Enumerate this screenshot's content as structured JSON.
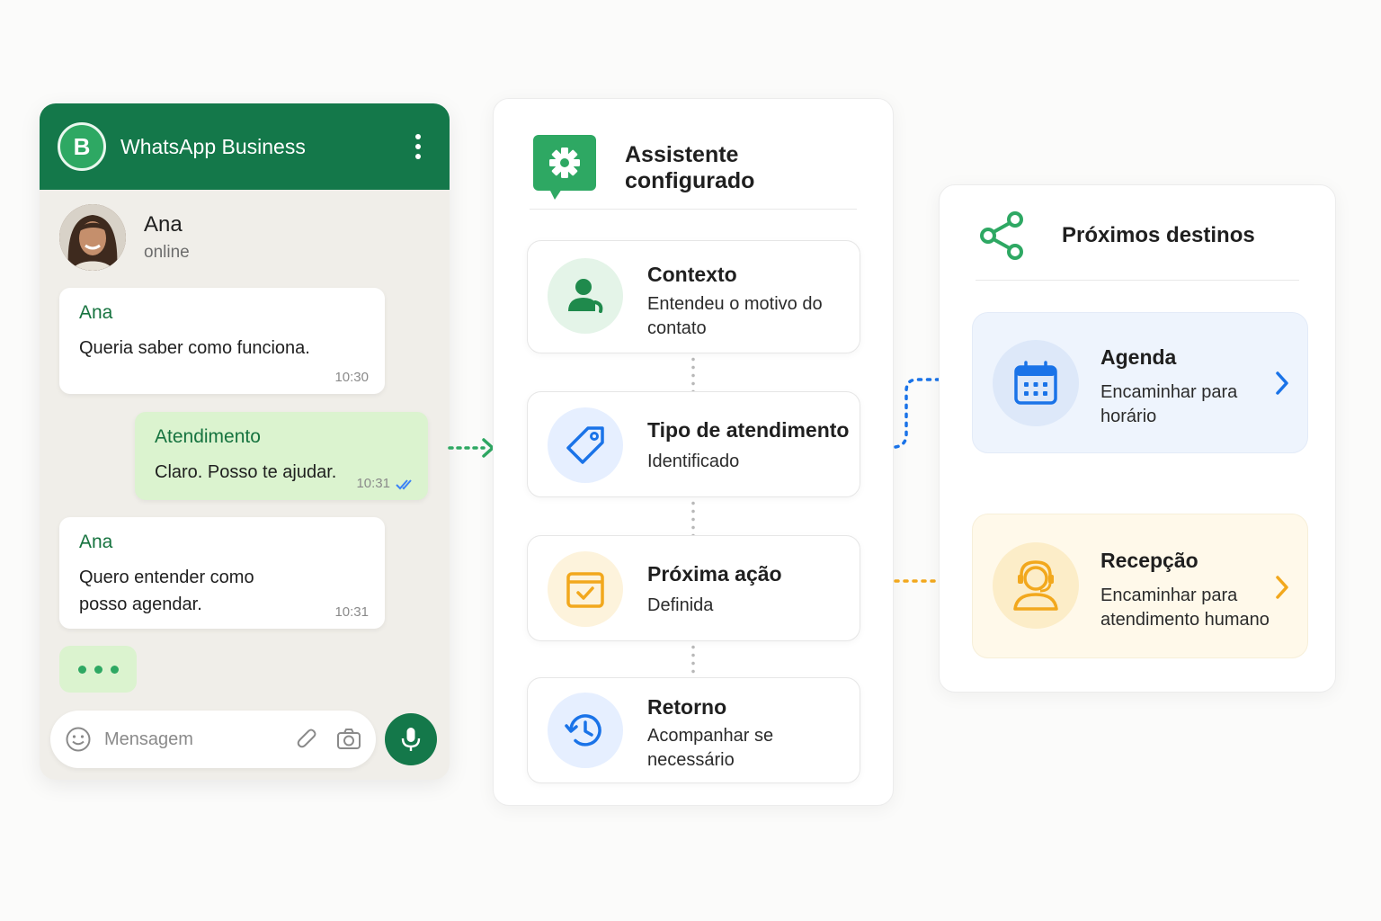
{
  "whatsapp": {
    "app_title": "WhatsApp Business",
    "contact_name": "Ana",
    "contact_status": "online",
    "messages": [
      {
        "sender": "Ana",
        "text": "Queria saber como funciona.",
        "time": "10:30"
      },
      {
        "sender": "Atendimento",
        "text": "Claro. Posso te ajudar.",
        "time": "10:31"
      },
      {
        "sender": "Ana",
        "text": "Quero entender como posso agendar.",
        "time": "10:31"
      }
    ],
    "input_placeholder": "Mensagem"
  },
  "assistant": {
    "title": "Assistente configurado",
    "steps": [
      {
        "title": "Contexto",
        "desc": "Entendeu o motivo do contato",
        "icon": "person-icon"
      },
      {
        "title": "Tipo de atendimento",
        "desc": "Identificado",
        "icon": "tag-icon"
      },
      {
        "title": "Próxima ação",
        "desc": "Definida",
        "icon": "calendar-check-icon"
      },
      {
        "title": "Retorno",
        "desc": "Acompanhar se necessário",
        "icon": "history-icon"
      }
    ]
  },
  "destinations": {
    "title": "Próximos destinos",
    "items": [
      {
        "title": "Agenda",
        "desc": "Encaminhar para horário",
        "icon": "calendar-icon"
      },
      {
        "title": "Recepção",
        "desc": "Encaminhar para atendimento humano",
        "icon": "headset-person-icon"
      }
    ]
  },
  "colors": {
    "whatsapp_green": "#14784a",
    "bubble_out": "#dbf3cf",
    "blue": "#1a73e8",
    "amber": "#f2a81d",
    "green": "#2ea863"
  }
}
